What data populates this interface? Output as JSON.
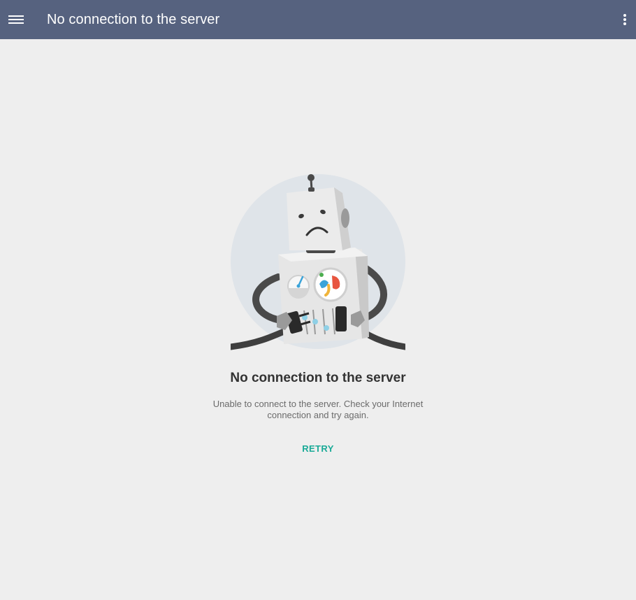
{
  "app_bar": {
    "title": "No connection to the server",
    "menu_icon": "hamburger-menu-icon",
    "more_icon": "more-vert-icon",
    "color": "#56627f"
  },
  "error": {
    "illustration": "disconnected-robot-illustration",
    "heading": "No connection to the server",
    "message": "Unable to connect to the server. Check your Internet connection and try again.",
    "retry_label": "RETRY"
  },
  "colors": {
    "accent": "#1aaa97",
    "background": "#eeeeee"
  }
}
